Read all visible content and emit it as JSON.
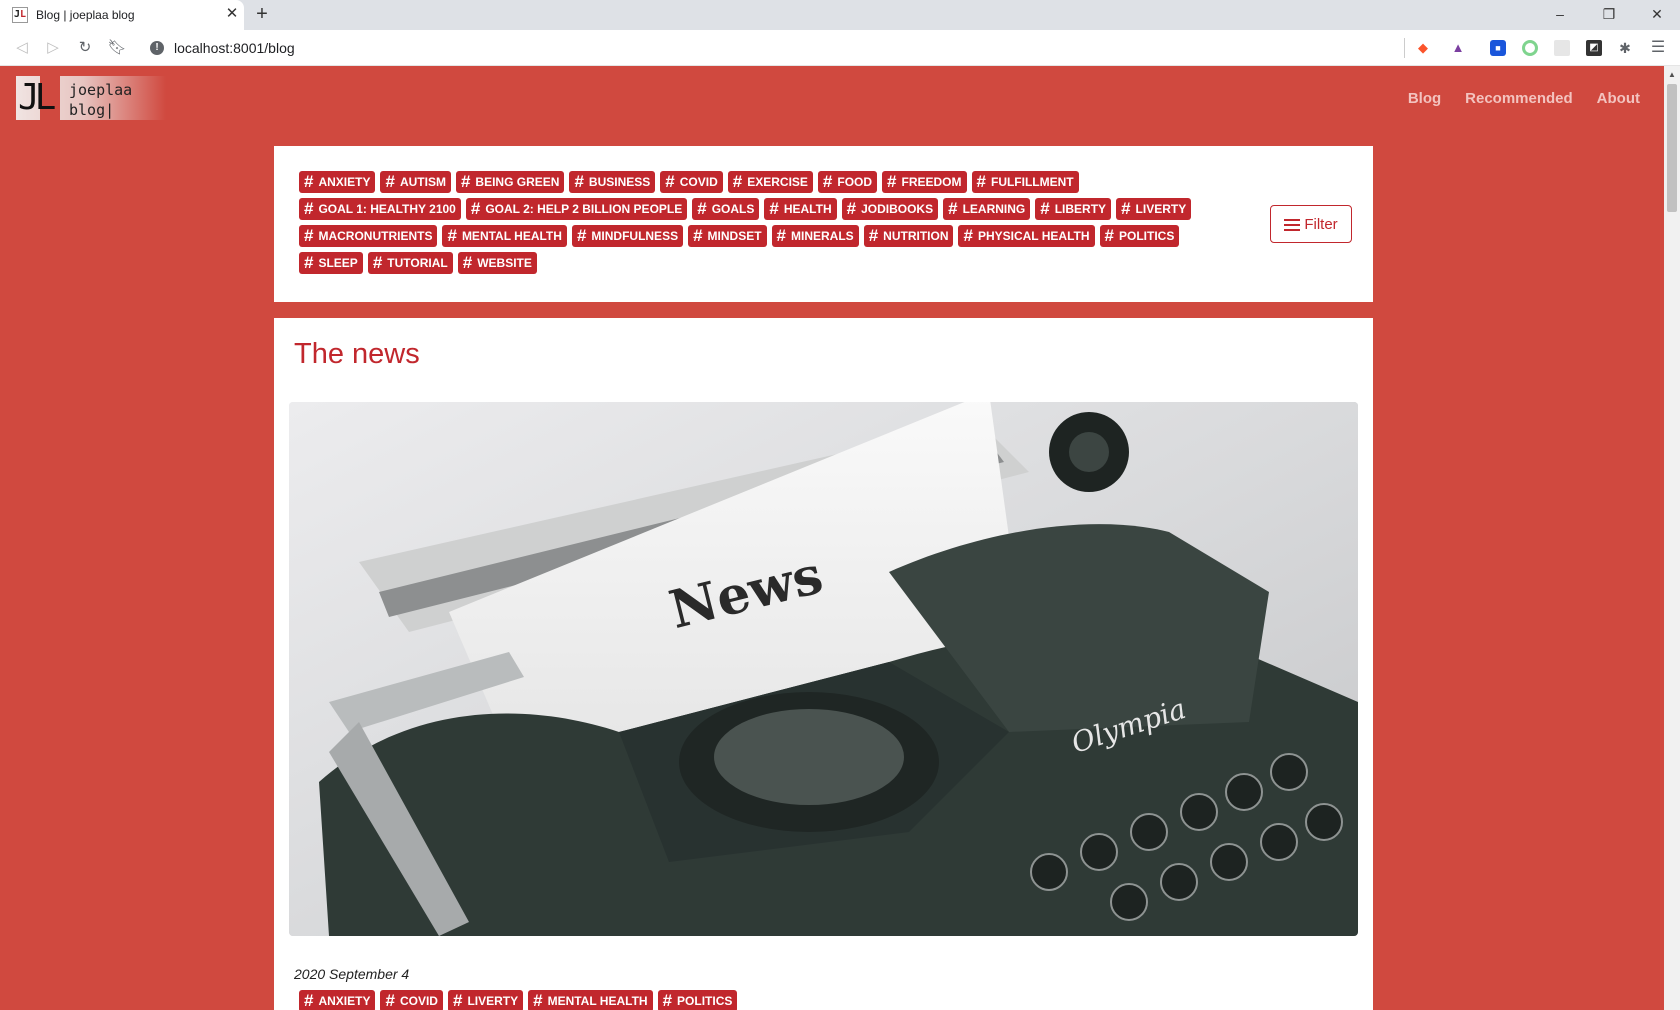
{
  "browser": {
    "tab_title": "Blog | joeplaa blog",
    "tab_favicon": "JL",
    "url": "localhost:8001/blog",
    "icons": [
      "back-icon",
      "forward-icon",
      "reload-icon",
      "bookmark-icon",
      "info-icon",
      "brave-shield-icon",
      "brave-rewards-icon",
      "extension-icon",
      "puzzle-icon",
      "menu-icon"
    ]
  },
  "site": {
    "logo_initials": "JL",
    "logo_text": "joeplaa\nblog|",
    "nav": [
      {
        "label": "Blog"
      },
      {
        "label": "Recommended"
      },
      {
        "label": "About"
      }
    ],
    "colors": {
      "background": "#d0493f",
      "accent": "#c1272d",
      "card": "#ffffff"
    }
  },
  "filter": {
    "button_label": "Filter",
    "tags": [
      "ANXIETY",
      "AUTISM",
      "BEING GREEN",
      "BUSINESS",
      "COVID",
      "EXERCISE",
      "FOOD",
      "FREEDOM",
      "FULFILLMENT",
      "GOAL 1: HEALTHY 2100",
      "GOAL 2: HELP 2 BILLION PEOPLE",
      "GOALS",
      "HEALTH",
      "JODIBOOKS",
      "LEARNING",
      "LIBERTY",
      "LIVERTY",
      "MACRONUTRIENTS",
      "MENTAL HEALTH",
      "MINDFULNESS",
      "MINDSET",
      "MINERALS",
      "NUTRITION",
      "PHYSICAL HEALTH",
      "POLITICS",
      "SLEEP",
      "TUTORIAL",
      "WEBSITE"
    ]
  },
  "post": {
    "title": "The news",
    "date": "2020 September 4",
    "image_text": "News",
    "image_brand": "Olympia",
    "tags": [
      "ANXIETY",
      "COVID",
      "LIVERTY",
      "MENTAL HEALTH",
      "POLITICS"
    ]
  }
}
